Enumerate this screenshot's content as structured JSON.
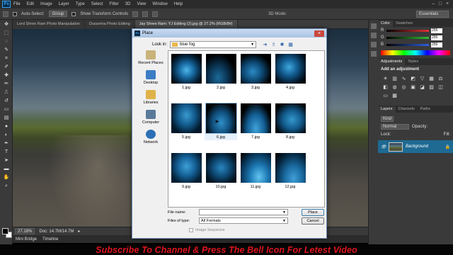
{
  "app": {
    "logo": "Ps",
    "menu": [
      "File",
      "Edit",
      "Image",
      "Layer",
      "Type",
      "Select",
      "Filter",
      "3D",
      "View",
      "Window",
      "Help"
    ]
  },
  "options": {
    "auto_select": "Auto-Select:",
    "group": "Group",
    "show_transform": "Show Transform Controls",
    "mode_3d": "3D Mode:",
    "workspace": "Essentials"
  },
  "document": {
    "tabs": [
      "Lord Shree Ram Photo Manipulation",
      "Dussehra Photo Editing",
      "Jay Shree Ram: YJ Editing (2).jpg @ 27.2% (RGB/8#)"
    ],
    "zoom": "27.18%",
    "doc_size": "Doc: 14.7M/14.7M"
  },
  "bottom_tabs": [
    "Mini Bridge",
    "Timeline"
  ],
  "panels": {
    "color_tabs": [
      "Color",
      "Swatches"
    ],
    "sliders": [
      {
        "letter": "R",
        "value": "255",
        "color": "#e03030"
      },
      {
        "letter": "G",
        "value": "255",
        "color": "#30c030"
      },
      {
        "letter": "B",
        "value": "255",
        "color": "#3060e0"
      }
    ],
    "adjustments_tabs": [
      "Adjustments",
      "Styles"
    ],
    "add_adjustment": "Add an adjustment",
    "layers_tabs": [
      "Layers",
      "Channels",
      "Paths"
    ],
    "kind": "Kind",
    "blend_mode": "Normal",
    "opacity_label": "Opacity:",
    "lock_label": "Lock:",
    "fill_label": "Fill:",
    "layer_name": "Background"
  },
  "dialog": {
    "title": "Place",
    "look_in_label": "Look in:",
    "look_in_value": "blue fog",
    "places": [
      {
        "label": "Recent Places",
        "color": "#c9b37a"
      },
      {
        "label": "Desktop",
        "color": "#3c7cc4"
      },
      {
        "label": "Libraries",
        "color": "#e0b24a"
      },
      {
        "label": "Computer",
        "color": "#5a7a9a"
      },
      {
        "label": "Network",
        "color": "#2b6fb5"
      }
    ],
    "files": [
      "1.jpg",
      "2.jpg",
      "3.jpg",
      "4.jpg",
      "5.jpg",
      "6.jpg",
      "7.jpg",
      "8.jpg",
      "9.jpg",
      "10.jpg",
      "11.jpg",
      "12.jpg"
    ],
    "file_name_label": "File name:",
    "file_name_value": "",
    "file_type_label": "Files of type:",
    "file_type_value": "All Formats",
    "place_button": "Place",
    "cancel_button": "Cancel",
    "image_sequence": "Image Sequence"
  },
  "banner": {
    "text": "Subscribe To Channel & Press The Bell Icon For Letest Video",
    "color": "#e0141e"
  }
}
